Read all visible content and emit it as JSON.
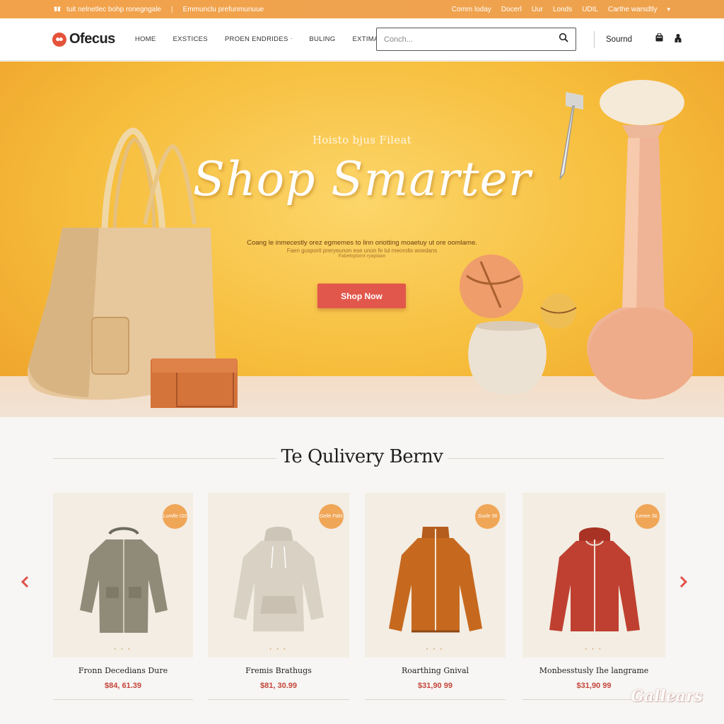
{
  "promo": {
    "left_text": "tuit nelnetlec bohp ronegngale",
    "mid_text": "Emmunclu prefunmunuue",
    "links": [
      "Comm loday",
      "Docerl",
      "Uur",
      "Londs",
      "UDIL",
      "Carthe warsdtly"
    ]
  },
  "header": {
    "logo_text": "Ofecus",
    "nav": [
      "HOME",
      "EXSTICES",
      "PROEN ENDRIDES",
      "BULING",
      "EXTIMATIES"
    ],
    "search_placeholder": "Conch...",
    "sound_label": "Sournd"
  },
  "hero": {
    "pretitle": "Hoisto bjus Fileat",
    "title": "Shop Smarter",
    "subtitle1": "Coang le inmecestly orez egmemes to linn oriotting moaetuy ut ore oomlame.",
    "subtitle2": "Faen gusporit preryeunon ese unon fe lul meorolis woedans",
    "subtitle3": "Fabekiplomt ryaplaan",
    "cta": "Shop Now"
  },
  "section": {
    "title": "Te Qulivery Bernv"
  },
  "products": [
    {
      "name": "Fronn Decedians Dure",
      "price": "$84, 61.39",
      "badge": "Lumfte IS0"
    },
    {
      "name": "Fremis Brathugs",
      "price": "$81, 30.99",
      "badge": "Gelle Fdiis"
    },
    {
      "name": "Roarthing Gnival",
      "price": "$31,90 99",
      "badge": "Suvle 36"
    },
    {
      "name": "Monbesstusly Ihe langrame",
      "price": "$31,90 99",
      "badge": "Lenee 3IL"
    }
  ],
  "watermark": "Gallears",
  "colors": {
    "accent": "#e2574c",
    "promo_bar": "#f0a34e",
    "badge": "#f0a657",
    "hero_yellow": "#f6bd3b"
  }
}
